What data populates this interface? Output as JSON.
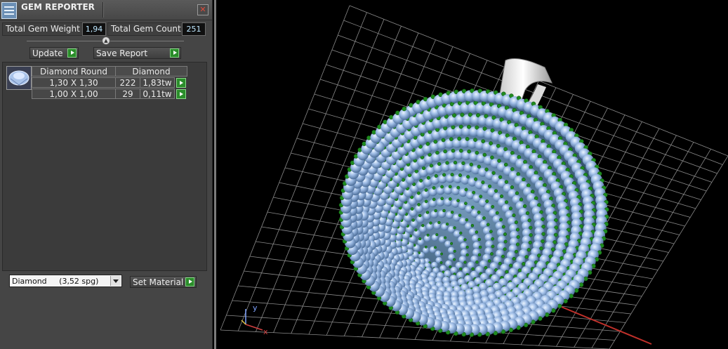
{
  "window": {
    "title": "GEM REPORTER"
  },
  "stats": {
    "weight_label": "Total Gem Weight",
    "weight_value": "1,94",
    "count_label": "Total Gem Count",
    "count_value": "251"
  },
  "buttons": {
    "update": "Update",
    "save_report": "Save Report",
    "set_material": "Set Material"
  },
  "table": {
    "headers": [
      "Diamond Round",
      "Diamond"
    ],
    "rows": [
      {
        "size": "1,30 X 1,30",
        "count": "222",
        "weight": "1,83tw"
      },
      {
        "size": "1,00 X 1,00",
        "count": "29",
        "weight": "0,11tw"
      }
    ]
  },
  "material": {
    "selected": "Diamond     (3,52 spg)"
  },
  "axes": {
    "x": "x",
    "y": "y"
  },
  "colors": {
    "panel_bg": "#454545",
    "accent_green": "#2a8d2a",
    "value_text": "#bfe8ff",
    "gem_blue": "#8fb4e0",
    "prong_green": "#1f8a1f"
  }
}
